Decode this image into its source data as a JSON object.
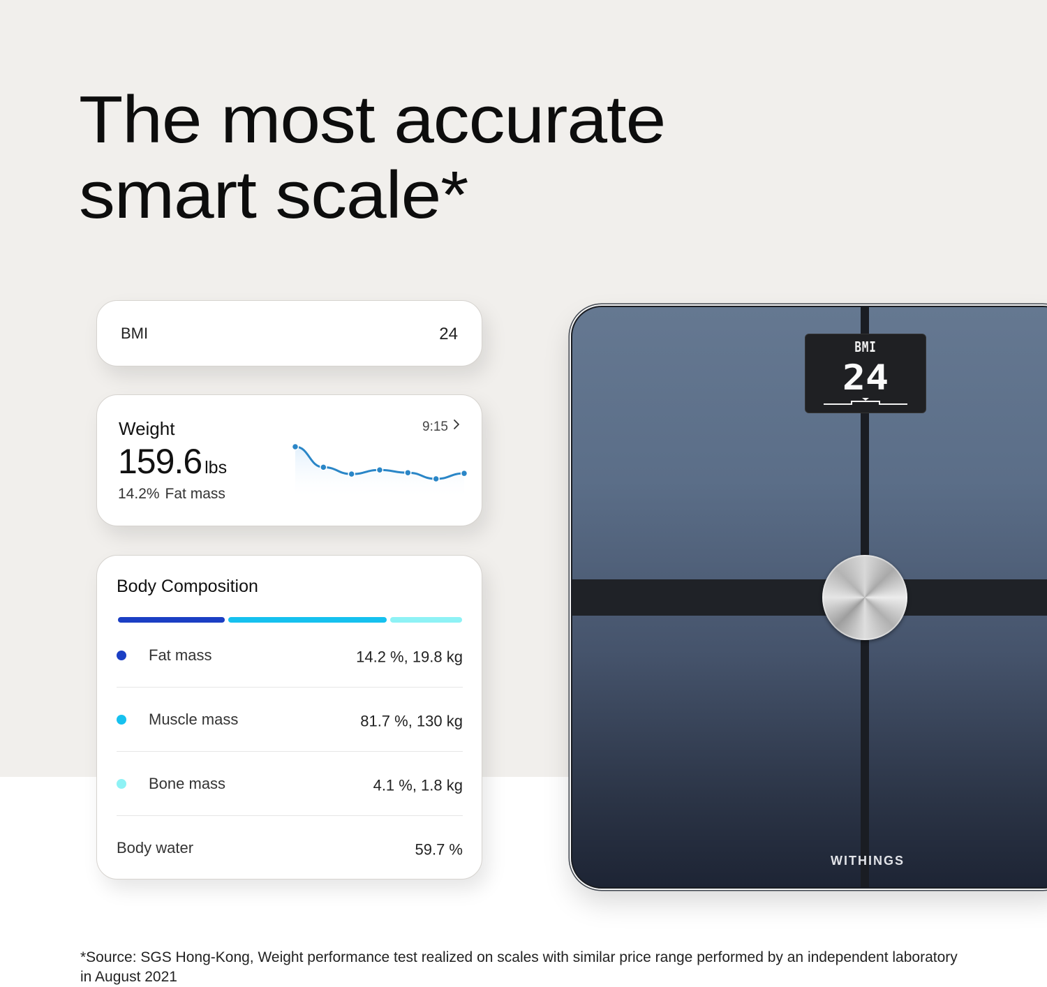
{
  "headline": {
    "line1": "The most accurate",
    "line2": "smart scale*"
  },
  "bmi_card": {
    "label": "BMI",
    "value": "24"
  },
  "weight_card": {
    "title": "Weight",
    "time": "9:15",
    "chevron_icon": "chevron-right-icon",
    "value": "159.6",
    "unit": "lbs",
    "fat_percent": "14.2%",
    "fat_label": "Fat mass",
    "trend": {
      "type": "line",
      "values": [
        8,
        5,
        4,
        4.6,
        4.2,
        3.3,
        4.1
      ],
      "color": "#2a86c7"
    }
  },
  "body_composition": {
    "title": "Body Composition",
    "bar_segments": [
      {
        "name": "fat",
        "color": "#1b3fc4",
        "weight": 31
      },
      {
        "name": "muscle",
        "color": "#16c1ef",
        "weight": 46
      },
      {
        "name": "bone",
        "color": "#8ef2f5",
        "weight": 21
      }
    ],
    "rows": [
      {
        "label": "Fat mass",
        "value": "14.2 %, 19.8 kg",
        "dot_color": "#1b3fc4"
      },
      {
        "label": "Muscle mass",
        "value": "81.7 %, 130 kg",
        "dot_color": "#16c1ef"
      },
      {
        "label": "Bone mass",
        "value": "4.1 %, 1.8 kg",
        "dot_color": "#8ef2f5"
      },
      {
        "label": "Body water",
        "value": "59.7 %",
        "dot_color": null
      }
    ]
  },
  "scale": {
    "display_label": "BMI",
    "display_value": "24",
    "brand": "WITHINGS"
  },
  "footnote": "*Source: SGS Hong-Kong, Weight performance test realized on scales with similar price range performed by an independent laboratory in August 2021"
}
